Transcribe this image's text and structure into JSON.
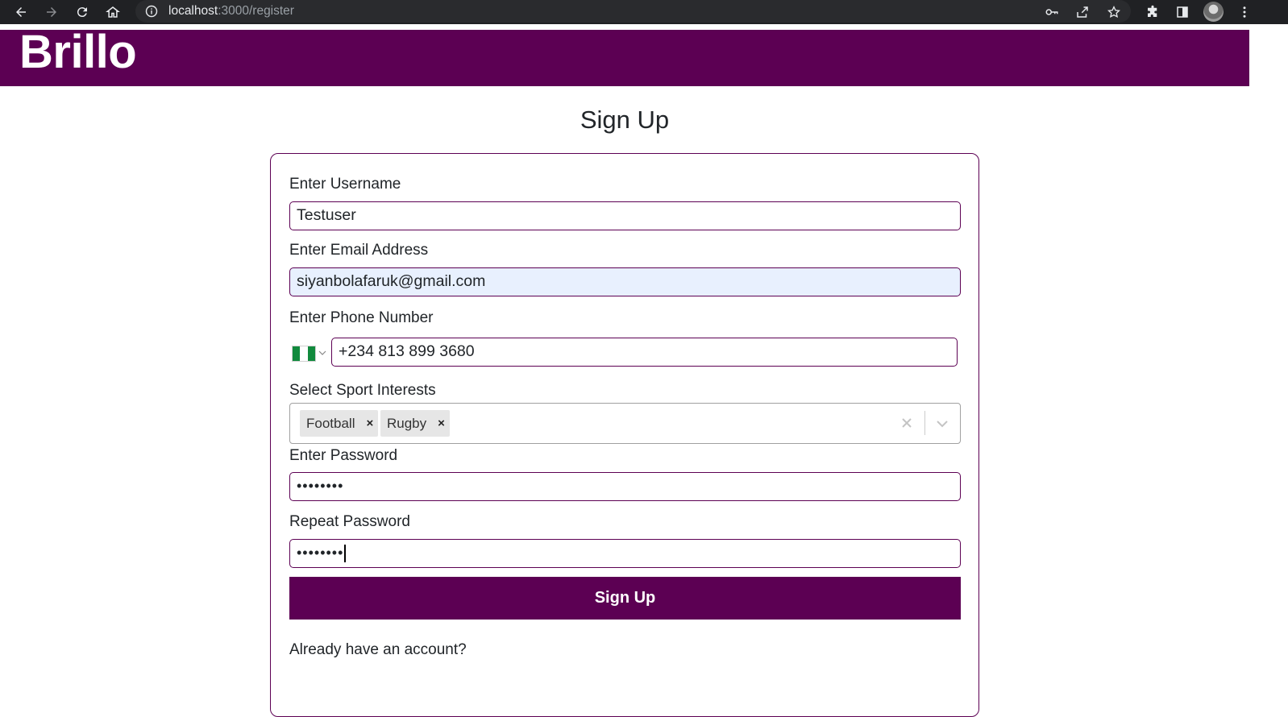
{
  "browser": {
    "url_host": "localhost",
    "url_path": ":3000/register"
  },
  "brand": {
    "name": "Brillo",
    "color": "#5c0053"
  },
  "page": {
    "title": "Sign Up"
  },
  "form": {
    "username": {
      "label": "Enter Username",
      "value": "Testuser"
    },
    "email": {
      "label": "Enter Email Address",
      "value": "siyanbolafaruk@gmail.com"
    },
    "phone": {
      "label": "Enter Phone Number",
      "value": "+234 813 899 3680",
      "country_flag": "nigeria-flag-icon"
    },
    "sports": {
      "label": "Select Sport Interests",
      "selected": [
        "Football",
        "Rugby"
      ],
      "remove_glyph": "×"
    },
    "password": {
      "label": "Enter Password",
      "value_masked": "••••••••"
    },
    "repeat_password": {
      "label": "Repeat Password",
      "value_masked": "••••••••"
    },
    "submit_label": "Sign Up",
    "signin_prompt": "Already have an account?"
  }
}
